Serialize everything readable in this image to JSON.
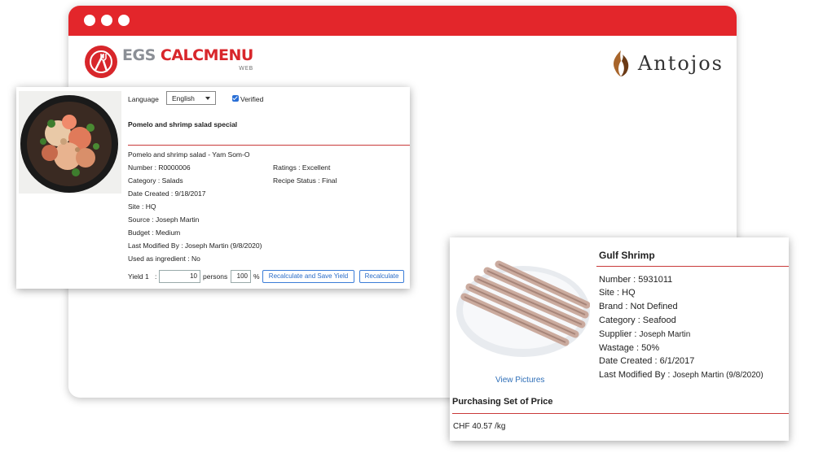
{
  "window": {
    "dots": 3,
    "titlebar_color": "#e3262b"
  },
  "logo": {
    "brand": "EGS",
    "product": "CALCMENU",
    "sub": "WEB"
  },
  "partner_brand": {
    "name": "Antojos",
    "icon": "flame-icon"
  },
  "recipe": {
    "image_alt": "pomelo-shrimp-salad-photo",
    "language_label": "Language",
    "language_value": "English",
    "verified_label": "Verified",
    "verified_checked": true,
    "title": "Pomelo and shrimp salad special",
    "subtitle": "Pomelo and shrimp salad - Yam Som-O",
    "number": "Number : R0000006",
    "category": "Category : Salads",
    "date_created": "Date Created : 9/18/2017",
    "site": "Site : HQ",
    "source": "Source : Joseph Martin",
    "budget": "Budget : Medium",
    "last_modified": "Last Modified By : Joseph Martin (9/8/2020)",
    "used_as_ingredient": "Used as ingredient : No",
    "ratings": "Ratings : Excellent",
    "recipe_status": "Recipe Status : Final",
    "yield_label": "Yield 1",
    "yield_colon": ":",
    "yield_value": "10",
    "persons_label": "persons",
    "percent_value": "100",
    "percent_label": "%",
    "recalc_save_label": "Recalculate and Save Yield",
    "recalc_label": "Recalculate"
  },
  "ingredient": {
    "image_alt": "gulf-shrimp-photo",
    "title": "Gulf Shrimp",
    "number": "Number : 5931011",
    "site": "Site : HQ",
    "brand": "Brand : Not Defined",
    "category": "Category : Seafood",
    "supplier_label": "Supplier : ",
    "supplier_value": "Joseph Martin",
    "wastage": "Wastage : 50%",
    "date_created": "Date Created : 6/1/2017",
    "last_modified_label": "Last Modified By : ",
    "last_modified_value": "Joseph Martin (9/8/2020)",
    "view_pictures": "View Pictures",
    "purchasing_title": "Purchasing Set of Price",
    "price": "CHF 40.57 /kg"
  }
}
